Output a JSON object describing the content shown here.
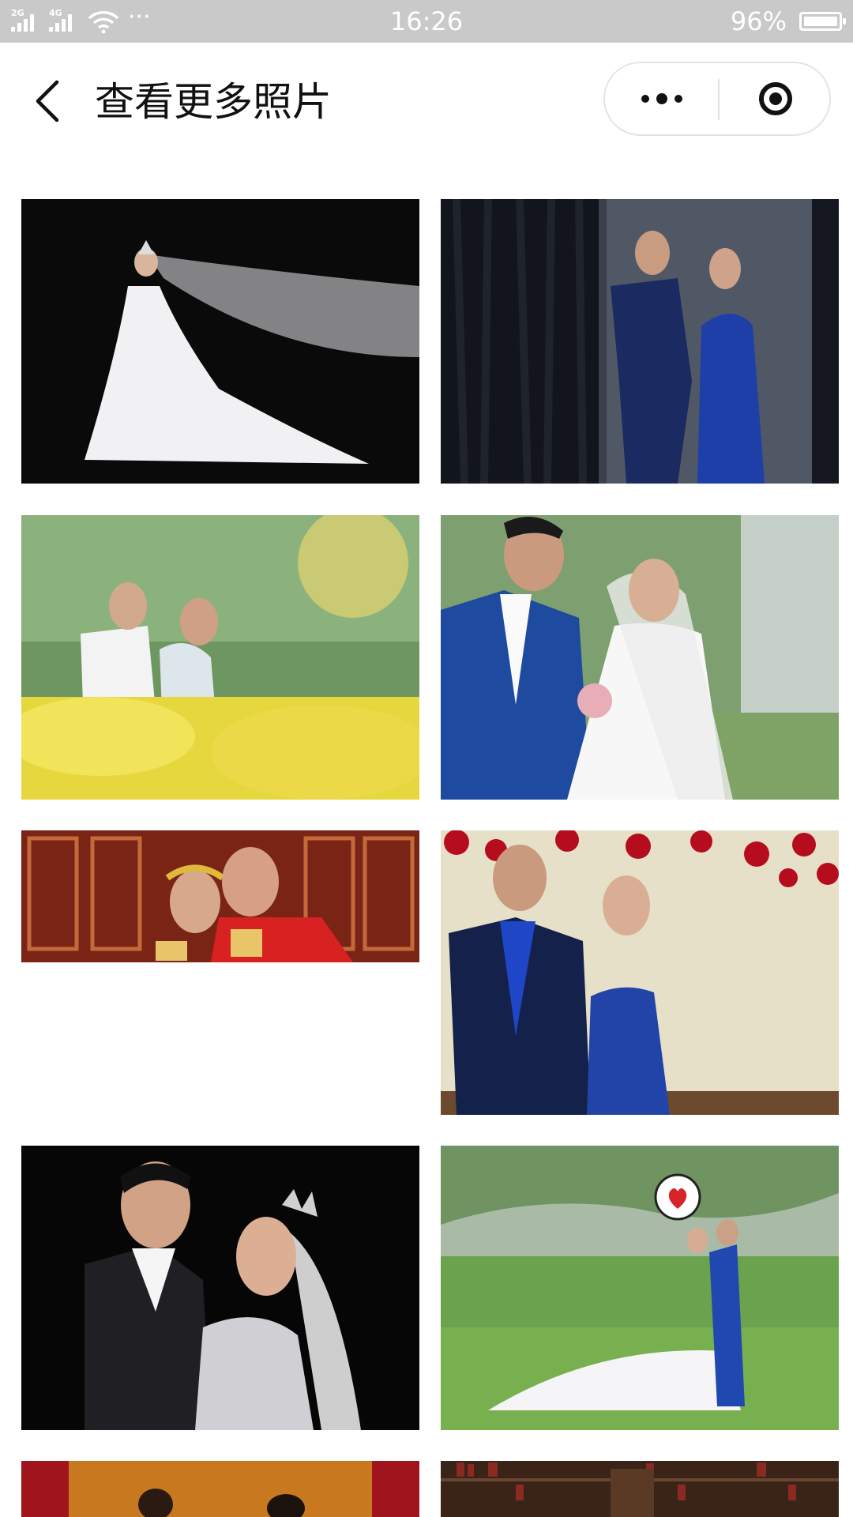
{
  "status_bar": {
    "network_1": "2G",
    "network_2": "4G",
    "more_dots": "···",
    "time": "16:26",
    "battery": "96%"
  },
  "nav": {
    "title": "查看更多照片"
  },
  "icons": [
    "back-icon",
    "more-icon",
    "close-icon",
    "wifi-icon",
    "signal-icon",
    "battery-icon"
  ],
  "photos": [
    {
      "desc_name": "bride-white-gown-black-bg"
    },
    {
      "desc_name": "couple-blue-outfits-curtain"
    },
    {
      "desc_name": "couple-yellow-flowers"
    },
    {
      "desc_name": "couple-blue-suit-garden"
    },
    {
      "desc_name": "couple-chinese-red-wedding"
    },
    {
      "desc_name": "couple-roses-wall"
    },
    {
      "desc_name": "couple-tiara-black-bg"
    },
    {
      "desc_name": "couple-lakeside-grass"
    },
    {
      "desc_name": "couple-orange-curtain"
    },
    {
      "desc_name": "couple-bookshelf"
    }
  ],
  "colors": {
    "status_bar_bg": "#c9c9c9",
    "nav_bg": "#ffffff",
    "title_text": "#111111"
  }
}
